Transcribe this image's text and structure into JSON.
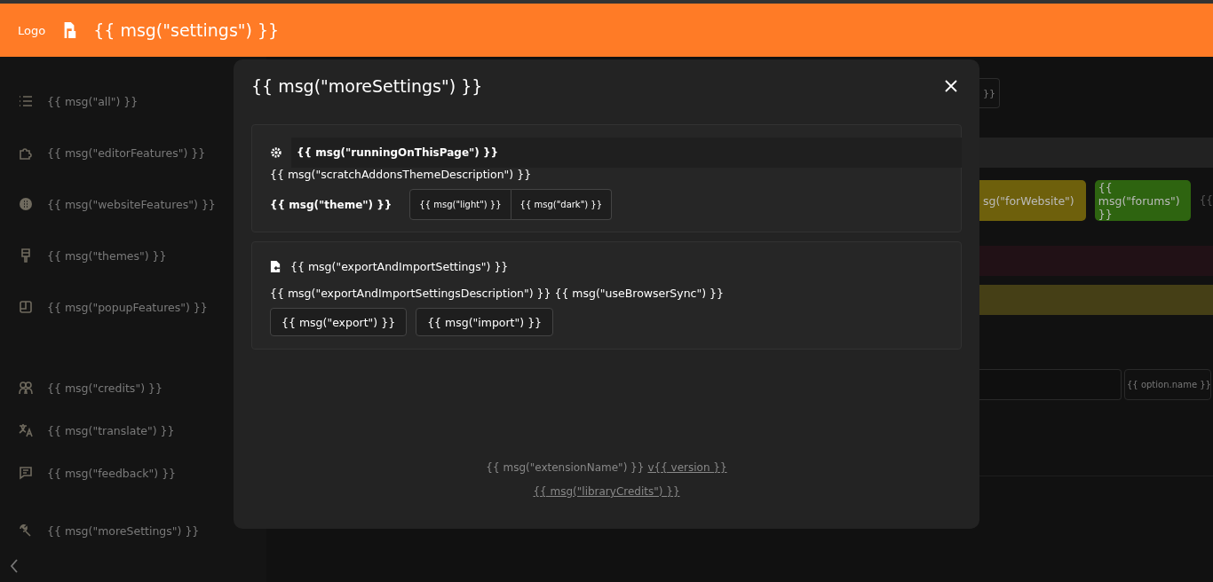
{
  "header": {
    "logo": "Logo",
    "title": "{{ msg(\"settings\") }}"
  },
  "sidebar": {
    "groups": [
      [
        {
          "label": "{{ msg(\"all\") }}"
        },
        {
          "label": "{{ msg(\"editorFeatures\") }}"
        },
        {
          "label": "{{ msg(\"websiteFeatures\") }}"
        },
        {
          "label": "{{ msg(\"themes\") }}"
        },
        {
          "label": "{{ msg(\"popupFeatures\") }}"
        }
      ],
      [
        {
          "label": "{{ msg(\"credits\") }}"
        },
        {
          "label": "{{ msg(\"translate\") }}"
        },
        {
          "label": "{{ msg(\"feedback\") }}"
        }
      ],
      [
        {
          "label": "{{ msg(\"moreSettings\") }}"
        }
      ]
    ]
  },
  "background": {
    "button": "}}",
    "tags": [
      {
        "text": "sg(\"forWebsite\")",
        "color": "#6e600c"
      },
      {
        "text": "{{ msg(\"forums\") }}",
        "color": "#2e6410"
      }
    ],
    "tag_overflow": "{{",
    "option_button": "{{ option.name }}"
  },
  "modal": {
    "title": "{{ msg(\"moreSettings\") }}",
    "theme_section": {
      "title": "{{ msg(\"runningOnThisPage\") }}",
      "description": "{{ msg(\"scratchAddonsThemeDescription\") }}",
      "label": "{{ msg(\"theme\") }}",
      "options": [
        "{{ msg(\"light\") }}",
        "{{ msg(\"dark\") }}"
      ]
    },
    "export_section": {
      "title": "{{ msg(\"exportAndImportSettings\") }}",
      "description": "{{ msg(\"exportAndImportSettingsDescription\") }} {{ msg(\"useBrowserSync\") }}",
      "buttons": [
        "{{ msg(\"export\") }}",
        "{{ msg(\"import\") }}"
      ]
    },
    "footer": {
      "extension_name": "{{ msg(\"extensionName\") }}",
      "version_link": "v{{ version }}",
      "credits_link": "{{ msg(\"libraryCredits\") }}"
    }
  }
}
